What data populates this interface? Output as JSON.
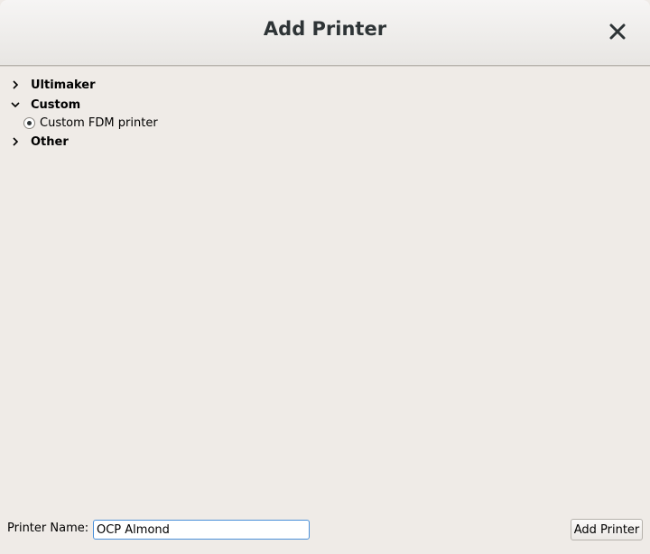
{
  "window": {
    "title": "Add Printer"
  },
  "tree": {
    "categories": [
      {
        "label": "Ultimaker",
        "expanded": false,
        "icon": "chevron-right-icon"
      },
      {
        "label": "Custom",
        "expanded": true,
        "icon": "chevron-down-icon",
        "items": [
          {
            "label": "Custom FDM printer",
            "selected": true
          }
        ]
      },
      {
        "label": "Other",
        "expanded": false,
        "icon": "chevron-right-icon"
      }
    ]
  },
  "footer": {
    "printer_name_label": "Printer Name:",
    "printer_name_value": "OCP Almond",
    "add_button_label": "Add Printer"
  },
  "colors": {
    "background": "#efebe7",
    "title_text": "#2e3436",
    "input_focus_border": "#4a90d9"
  }
}
